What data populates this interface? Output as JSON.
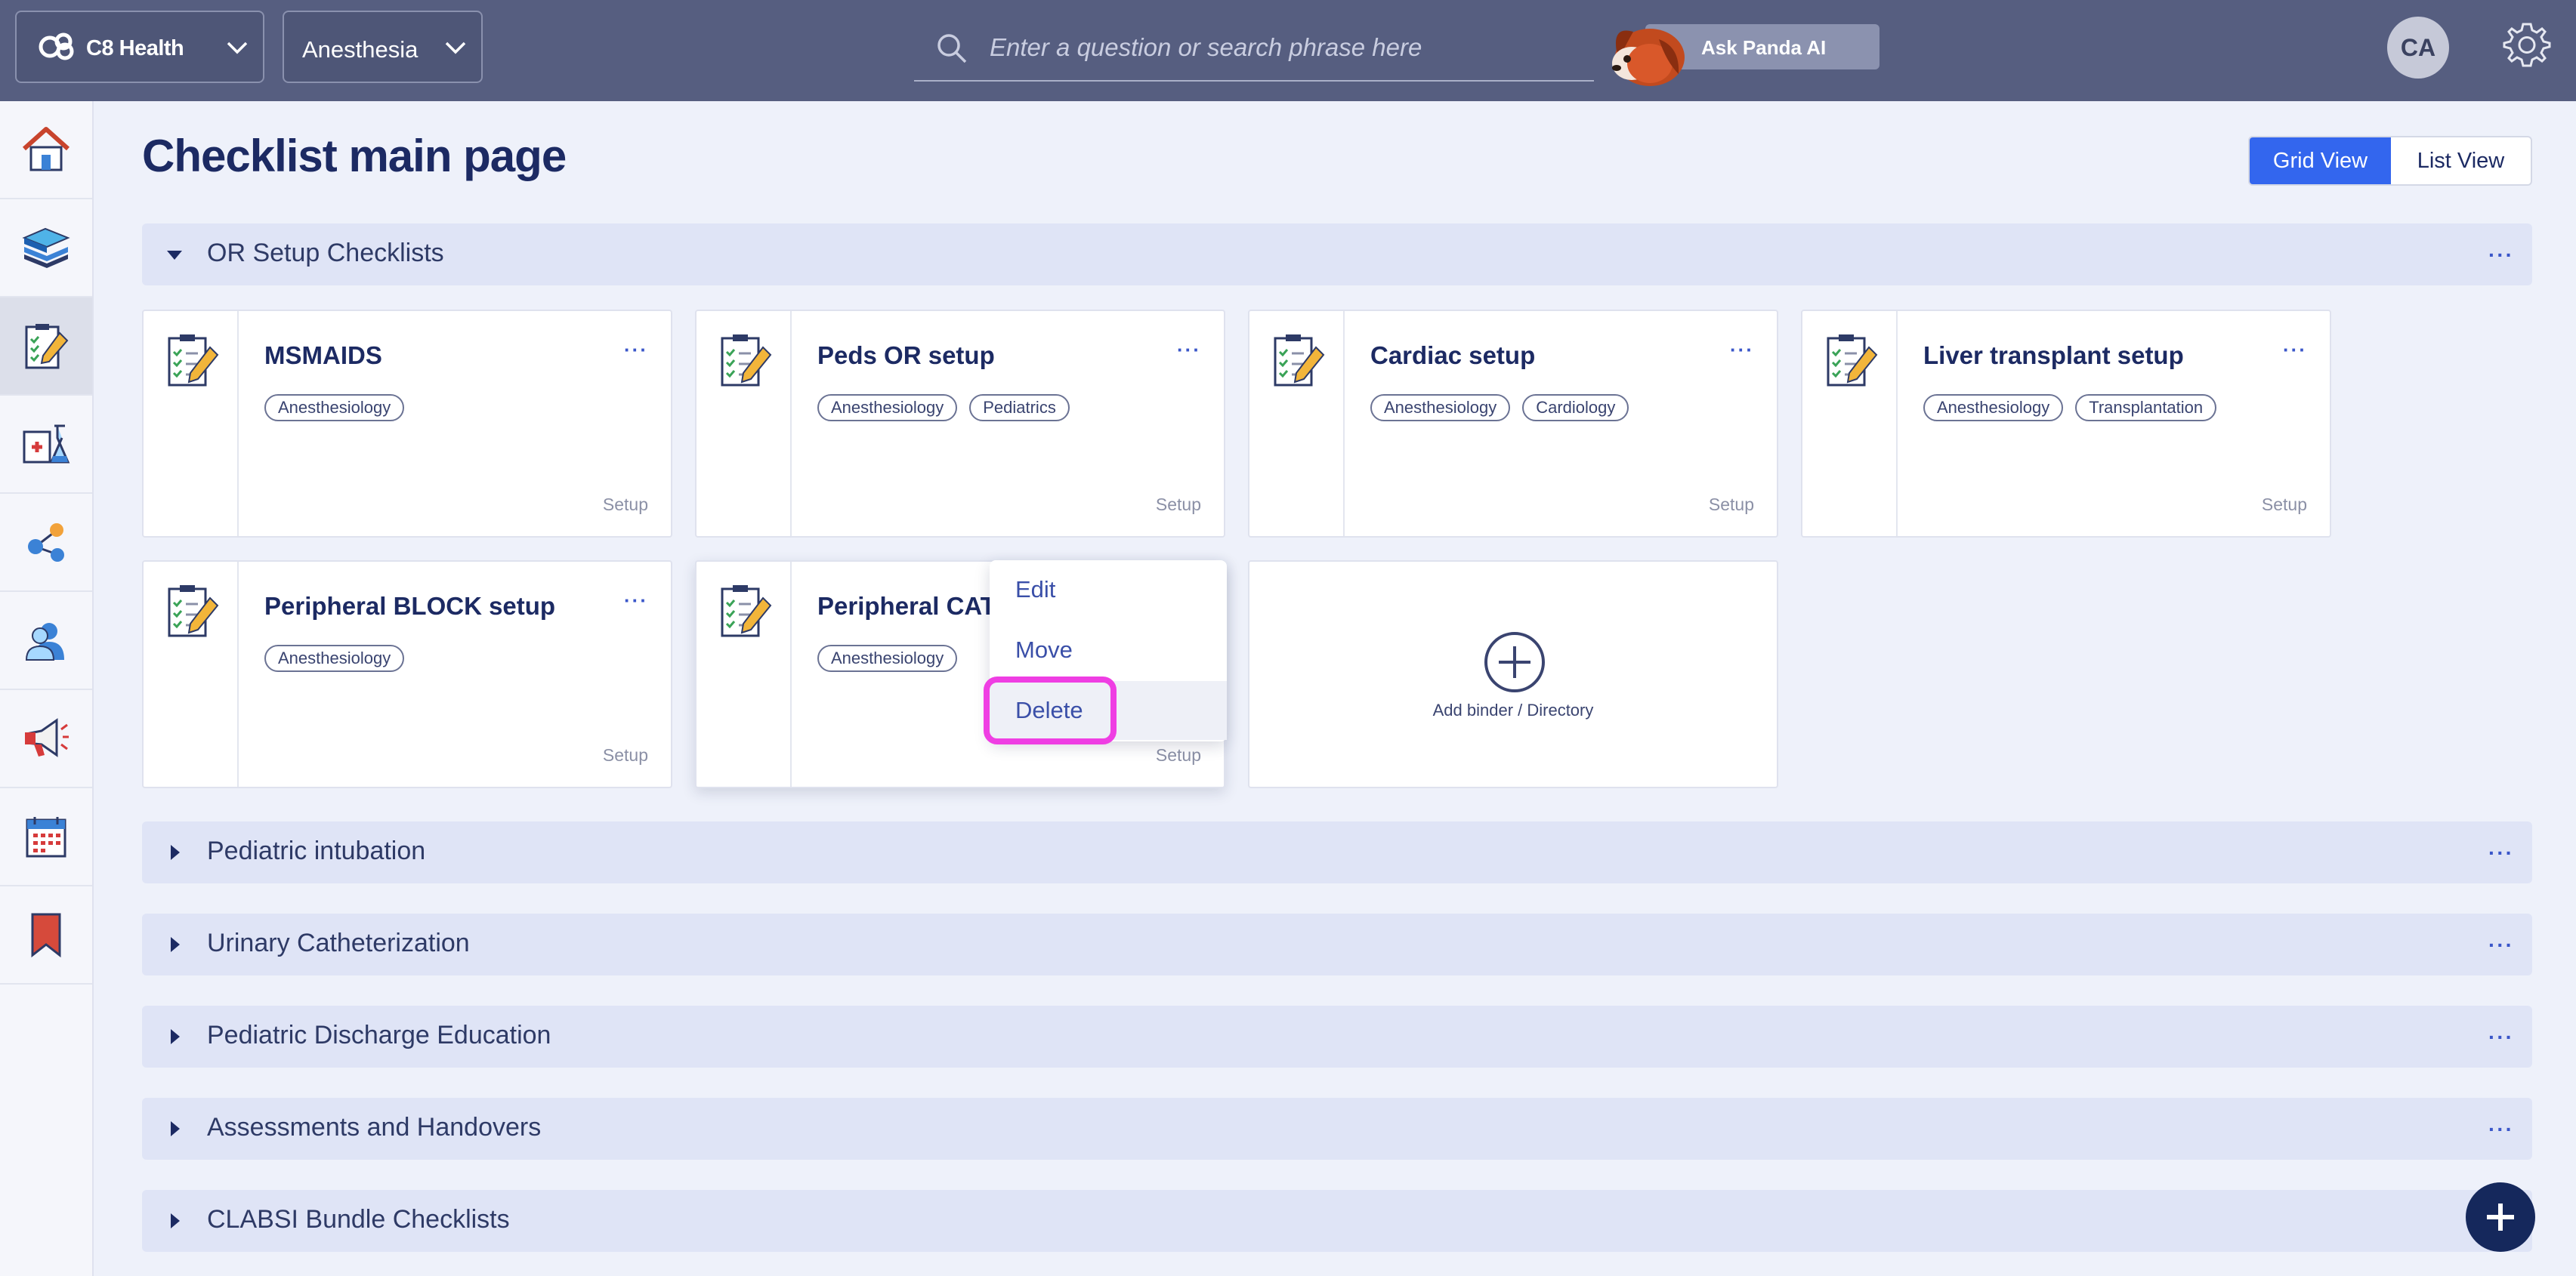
{
  "header": {
    "org_name": "C8 Health",
    "department": "Anesthesia",
    "search_placeholder": "Enter a question or search phrase here",
    "ask_ai_label": "Ask Panda AI",
    "user_initials": "CA"
  },
  "sidebar": {
    "items": [
      "home-icon",
      "library-books-icon",
      "checklist-icon",
      "lab-icon",
      "network-icon",
      "users-icon",
      "announcements-icon",
      "calendar-icon",
      "bookmark-icon"
    ],
    "active": "checklist-icon"
  },
  "page": {
    "title": "Checklist main page",
    "view_grid": "Grid View",
    "view_list": "List View",
    "active_view": "Grid View"
  },
  "sections": [
    {
      "title": "OR Setup Checklists",
      "expanded": true
    },
    {
      "title": "Pediatric intubation",
      "expanded": false
    },
    {
      "title": "Urinary Catheterization",
      "expanded": false
    },
    {
      "title": "Pediatric Discharge Education",
      "expanded": false
    },
    {
      "title": "Assessments and Handovers",
      "expanded": false
    },
    {
      "title": "CLABSI Bundle Checklists",
      "expanded": false
    }
  ],
  "cards": [
    {
      "title": "MSMAIDS",
      "tags": [
        "Anesthesiology"
      ],
      "type": "Setup"
    },
    {
      "title": "Peds OR setup",
      "tags": [
        "Anesthesiology",
        "Pediatrics"
      ],
      "type": "Setup"
    },
    {
      "title": "Cardiac setup",
      "tags": [
        "Anesthesiology",
        "Cardiology"
      ],
      "type": "Setup"
    },
    {
      "title": "Liver transplant setup",
      "tags": [
        "Anesthesiology",
        "Transplantation"
      ],
      "type": "Setup"
    },
    {
      "title": "Peripheral BLOCK setup",
      "tags": [
        "Anesthesiology"
      ],
      "type": "Setup"
    },
    {
      "title": "Peripheral CAT",
      "tags": [
        "Anesthesiology"
      ],
      "type": "Setup"
    }
  ],
  "add_card": {
    "label": "Add binder / Directory"
  },
  "context_menu": {
    "items": [
      "Edit",
      "Move",
      "Delete"
    ],
    "highlighted": "Delete"
  },
  "more_glyph": "···",
  "colors": {
    "accent": "#3366ee",
    "topbar": "#565e80",
    "highlight_ring": "#ef3ee3",
    "fab": "#15285c"
  }
}
